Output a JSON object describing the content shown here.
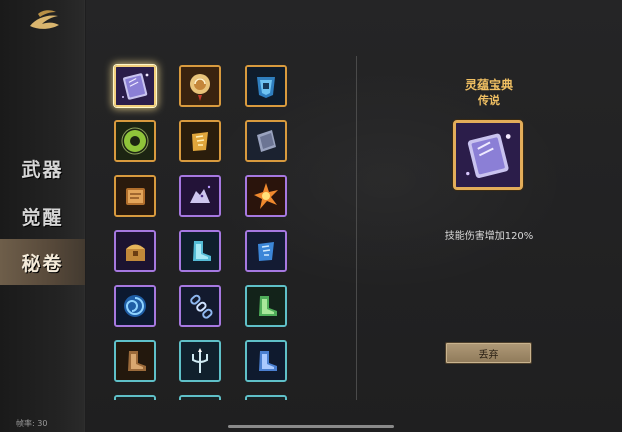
{
  "sidebar": {
    "logo_icon": "dragon-crest-icon",
    "items": [
      {
        "label": "武器",
        "active": false
      },
      {
        "label": "觉醒",
        "active": false
      },
      {
        "label": "秘卷",
        "active": true
      }
    ],
    "fps_text": "帧率: 30"
  },
  "grid": {
    "rows": [
      [
        {
          "icon": "purple-book-icon",
          "rarity": "orange",
          "selected": true
        },
        {
          "icon": "golden-scroll-icon",
          "rarity": "orange"
        },
        {
          "icon": "blue-mask-icon",
          "rarity": "orange"
        }
      ],
      [
        {
          "icon": "green-ring-icon",
          "rarity": "orange"
        },
        {
          "icon": "gold-rune-icon",
          "rarity": "orange"
        },
        {
          "icon": "stone-tablet-icon",
          "rarity": "orange"
        }
      ],
      [
        {
          "icon": "leather-tome-icon",
          "rarity": "orange"
        },
        {
          "icon": "wolf-spirit-icon",
          "rarity": "purple"
        },
        {
          "icon": "flame-burst-icon",
          "rarity": "purple"
        }
      ],
      [
        {
          "icon": "treasure-chest-icon",
          "rarity": "purple"
        },
        {
          "icon": "ice-boot-icon",
          "rarity": "purple"
        },
        {
          "icon": "blue-rune-icon",
          "rarity": "purple"
        }
      ],
      [
        {
          "icon": "blue-swirl-icon",
          "rarity": "purple"
        },
        {
          "icon": "chain-icon",
          "rarity": "purple"
        },
        {
          "icon": "green-boot-icon",
          "rarity": "cyan"
        }
      ],
      [
        {
          "icon": "brown-boot-icon",
          "rarity": "cyan"
        },
        {
          "icon": "trident-icon",
          "rarity": "cyan"
        },
        {
          "icon": "blue-boot-icon",
          "rarity": "cyan"
        }
      ],
      [
        {
          "icon": "partial-item-icon",
          "rarity": "cyan"
        },
        {
          "icon": "partial-item-icon",
          "rarity": "cyan"
        },
        {
          "icon": "partial-item-icon",
          "rarity": "cyan"
        }
      ]
    ]
  },
  "detail": {
    "name": "灵蕴宝典",
    "rarity": "传说",
    "icon": "purple-book-icon",
    "description": "技能伤害增加120%",
    "discard_label": "丢弃"
  },
  "colors": {
    "orange": "#d89a3e",
    "purple": "#a678e0",
    "cyan": "#5fc0c8",
    "gold_text": "#f1c063"
  }
}
